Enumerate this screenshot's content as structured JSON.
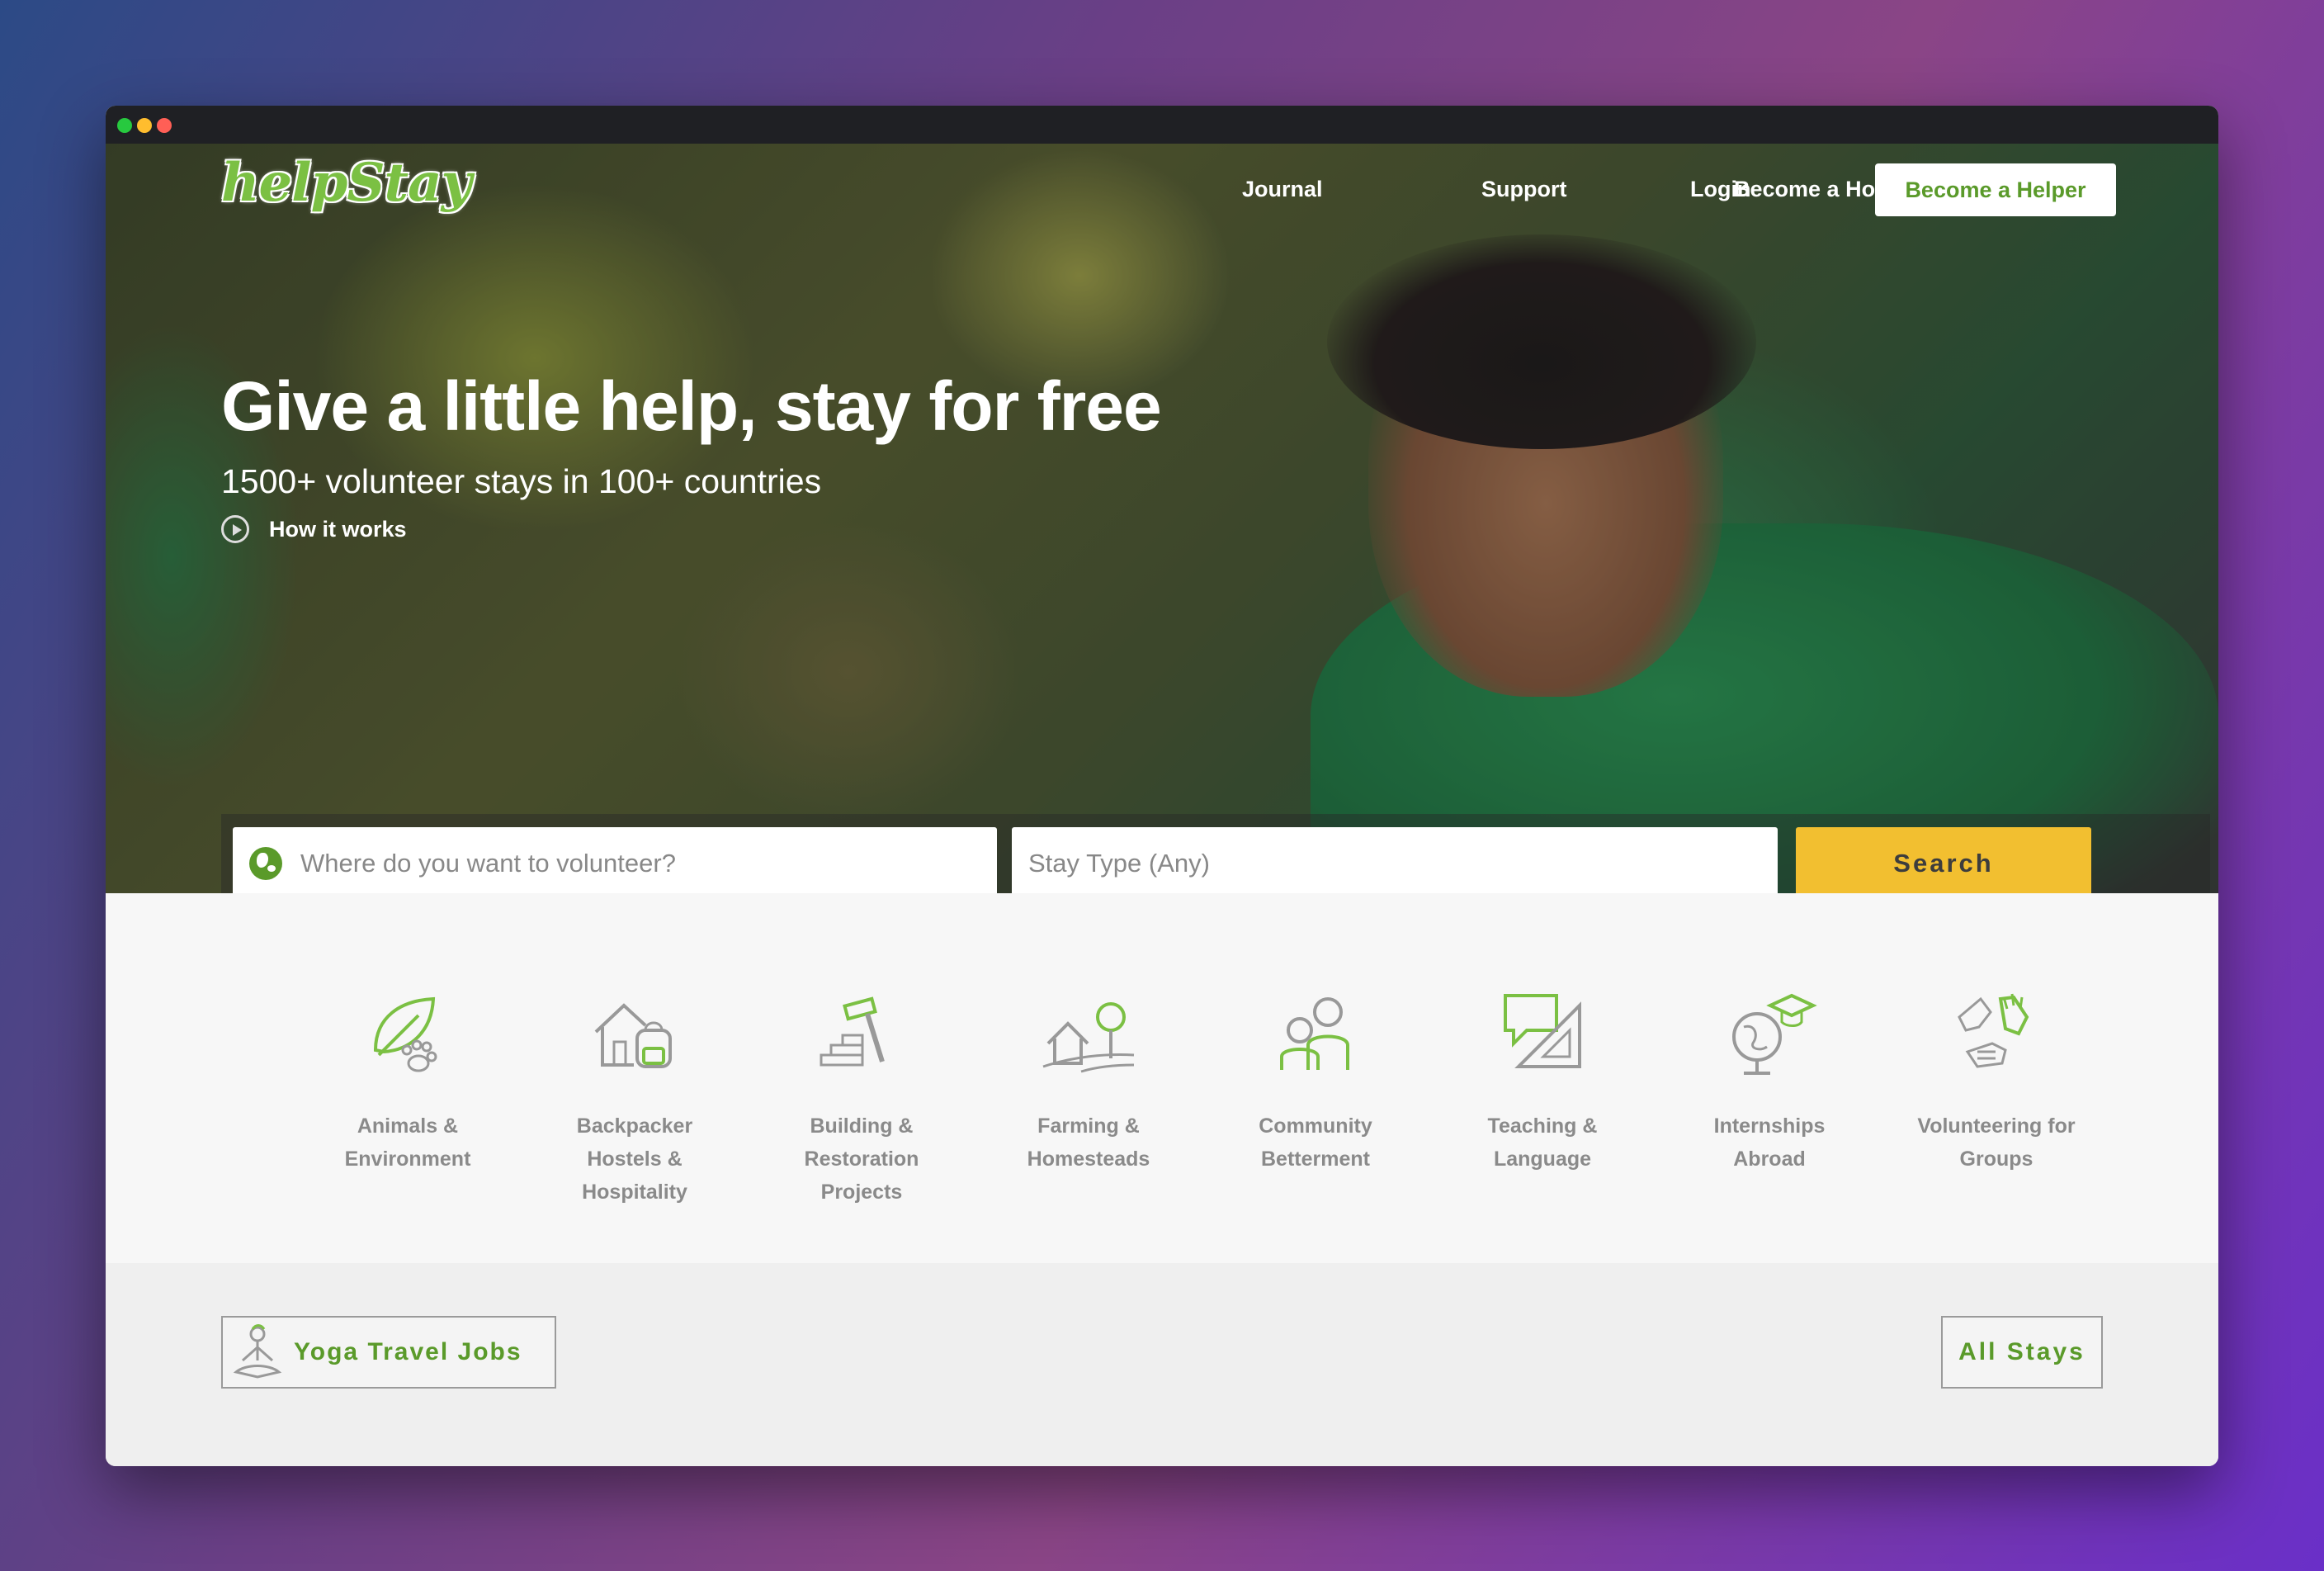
{
  "brand": {
    "logo_text": "helpStay",
    "accent_color": "#5a9a2a",
    "search_color": "#f2bf30"
  },
  "nav": {
    "links": [
      "Journal",
      "Support",
      "Login",
      "Become a Host"
    ],
    "cta_label": "Become a Helper"
  },
  "hero": {
    "headline": "Give a little help, stay for free",
    "subheadline": "1500+ volunteer stays in 100+ countries",
    "how_it_works": "How it works"
  },
  "search": {
    "where_placeholder": "Where do you want to volunteer?",
    "stay_type_value": "Stay Type (Any)",
    "button_label": "Search"
  },
  "categories": [
    {
      "lines": [
        "Animals &",
        "Environment"
      ],
      "icon": "leaf-paw-icon"
    },
    {
      "lines": [
        "Backpacker",
        "Hostels &",
        "Hospitality"
      ],
      "icon": "hostel-backpack-icon"
    },
    {
      "lines": [
        "Building &",
        "Restoration",
        "Projects"
      ],
      "icon": "bricks-hammer-icon"
    },
    {
      "lines": [
        "Farming &",
        "Homesteads"
      ],
      "icon": "farmhouse-tree-icon"
    },
    {
      "lines": [
        "Community",
        "Betterment"
      ],
      "icon": "people-icon"
    },
    {
      "lines": [
        "Teaching &",
        "Language"
      ],
      "icon": "speech-ruler-icon"
    },
    {
      "lines": [
        "Internships",
        "Abroad"
      ],
      "icon": "globe-graduation-icon"
    },
    {
      "lines": [
        "Volunteering for",
        "Groups"
      ],
      "icon": "raised-hands-icon"
    }
  ],
  "footer_actions": {
    "yoga_label": "Yoga Travel Jobs",
    "all_stays_label": "All Stays"
  }
}
